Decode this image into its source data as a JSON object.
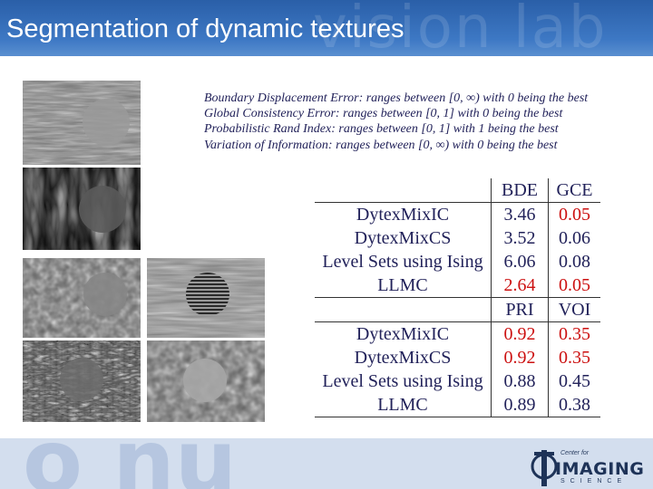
{
  "title": "Segmentation of dynamic textures",
  "watermark": {
    "top_text": "vision lab",
    "bottom_text": "o nu"
  },
  "notes": [
    {
      "metric": "Boundary Displacement Error:",
      "range": " ranges between [0, ∞) with 0 being the best"
    },
    {
      "metric": "Global Consistency Error:",
      "range": " ranges between [0, 1] with 0 being the best"
    },
    {
      "metric": "Probabilistic Rand Index:",
      "range": " ranges between [0, 1] with 1 being the best"
    },
    {
      "metric": "Variation of Information:",
      "range": " ranges between [0, ∞) with 0 being the best"
    }
  ],
  "results_table": {
    "header_top": [
      "",
      "BDE",
      "GCE"
    ],
    "rows_top": [
      {
        "method": "DytexMixIC",
        "v1": "3.46",
        "v2": "0.05",
        "v1_best": false,
        "v2_best": true
      },
      {
        "method": "DytexMixCS",
        "v1": "3.52",
        "v2": "0.06",
        "v1_best": false,
        "v2_best": false
      },
      {
        "method": "Level Sets using Ising",
        "v1": "6.06",
        "v2": "0.08",
        "v1_best": false,
        "v2_best": false
      },
      {
        "method": "LLMC",
        "v1": "2.64",
        "v2": "0.05",
        "v1_best": true,
        "v2_best": true
      }
    ],
    "header_bottom": [
      "",
      "PRI",
      "VOI"
    ],
    "rows_bottom": [
      {
        "method": "DytexMixIC",
        "v1": "0.92",
        "v2": "0.35",
        "v1_best": true,
        "v2_best": true
      },
      {
        "method": "DytexMixCS",
        "v1": "0.92",
        "v2": "0.35",
        "v1_best": true,
        "v2_best": true
      },
      {
        "method": "Level Sets using Ising",
        "v1": "0.88",
        "v2": "0.45",
        "v1_best": false,
        "v2_best": false
      },
      {
        "method": "LLMC",
        "v1": "0.89",
        "v2": "0.38",
        "v1_best": false,
        "v2_best": false
      }
    ]
  },
  "logo": {
    "line1": "Center for",
    "line2": "IMAGING",
    "line3": "SCIENCE"
  },
  "colors": {
    "header": "#3d78c4",
    "text": "#22225a",
    "best": "#cc1111",
    "footer": "#d3deee"
  }
}
